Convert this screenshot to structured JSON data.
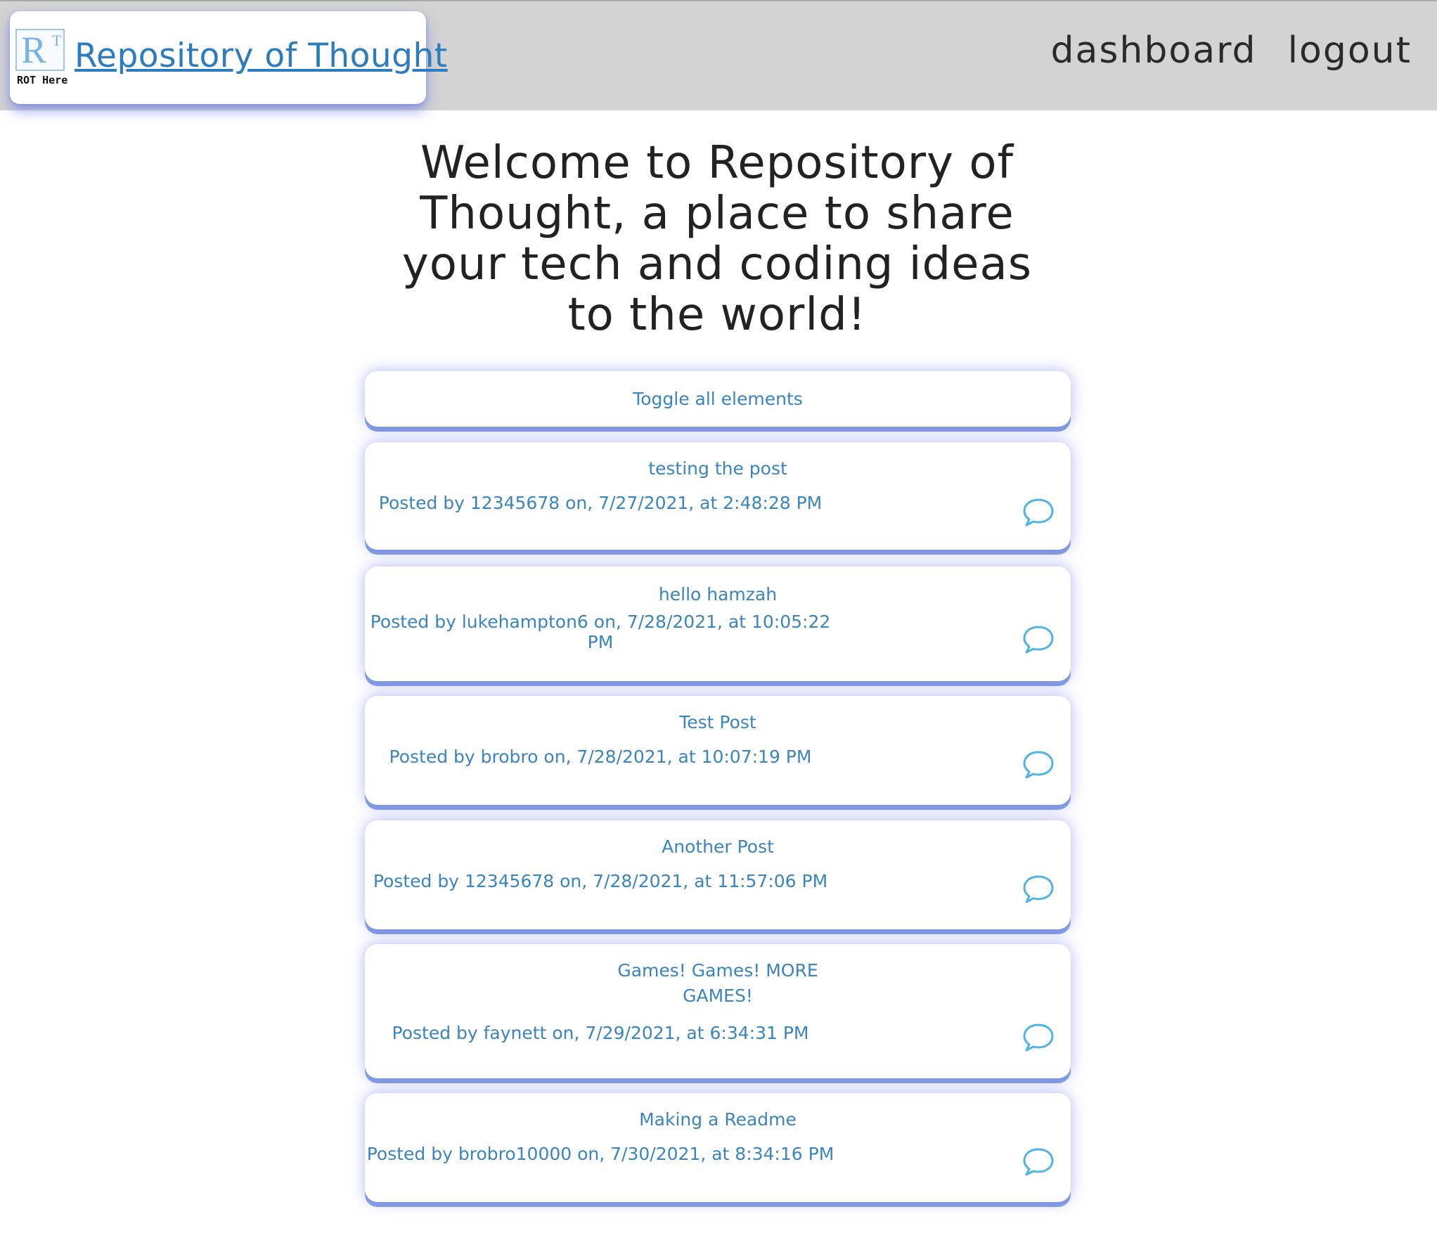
{
  "header": {
    "logo_caption": "ROT Here",
    "logo_letters": "RT",
    "title": "Repository of Thought",
    "nav": [
      {
        "label": "dashboard"
      },
      {
        "label": "logout"
      }
    ]
  },
  "welcome": "Welcome to Repository of Thought, a place to share your tech and coding ideas to the world!",
  "toggle_label": "Toggle all elements",
  "posts": [
    {
      "title": "testing the post",
      "meta": "Posted by 12345678 on, 7/27/2021, at 2:48:28 PM"
    },
    {
      "title": "hello hamzah",
      "meta": "Posted by lukehampton6 on, 7/28/2021, at 10:05:22 PM"
    },
    {
      "title": "Test Post",
      "meta": "Posted by brobro on, 7/28/2021, at 10:07:19 PM"
    },
    {
      "title": "Another Post",
      "meta": "Posted by 12345678 on, 7/28/2021, at 11:57:06 PM"
    },
    {
      "title": "Games! Games! MORE GAMES!",
      "meta": "Posted by faynett on, 7/29/2021, at 6:34:31 PM"
    },
    {
      "title": "Making a Readme",
      "meta": "Posted by brobro10000 on, 7/30/2021, at 8:34:16 PM"
    }
  ],
  "colors": {
    "accent": "#3a84bf",
    "icon": "#4fb3e6",
    "header_bg": "#d3d3d3",
    "shadow": "#6a7ee0"
  },
  "icons": {
    "comment": "speech-bubble-icon"
  }
}
